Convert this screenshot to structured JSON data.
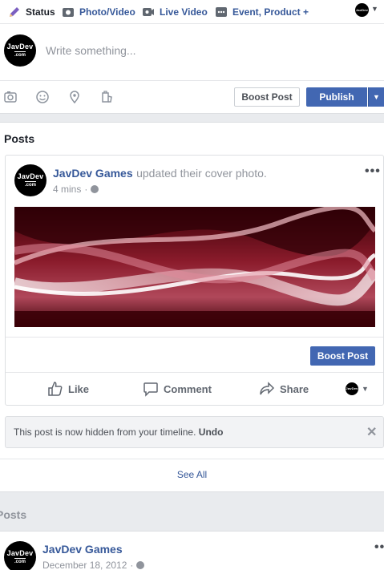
{
  "composer": {
    "tabs": [
      {
        "label": "Status",
        "icon": "pencil-icon"
      },
      {
        "label": "Photo/Video",
        "icon": "camera-icon"
      },
      {
        "label": "Live Video",
        "icon": "video-camera-icon"
      },
      {
        "label": "Event, Product +",
        "icon": "more-icon"
      }
    ],
    "placeholder": "Write something...",
    "boost_label": "Boost Post",
    "publish_label": "Publish"
  },
  "page": {
    "avatar_line1": "JavDev",
    "avatar_line2": ".com",
    "name": "JavDev Games"
  },
  "posts": {
    "title": "Posts",
    "post": {
      "author": "JavDev Games",
      "action": "updated their cover photo.",
      "time": "4 mins",
      "boost_label": "Boost Post",
      "like": "Like",
      "comment": "Comment",
      "share": "Share"
    },
    "hidden_notice": "This post is now hidden from your timeline.",
    "undo": "Undo",
    "see_all": "See All"
  },
  "posts2": {
    "title": "Posts",
    "author": "JavDev Games",
    "date": "December 18, 2012"
  },
  "colors": {
    "brand_blue": "#4267b2",
    "link_blue": "#365899",
    "background": "#e9ebee"
  }
}
